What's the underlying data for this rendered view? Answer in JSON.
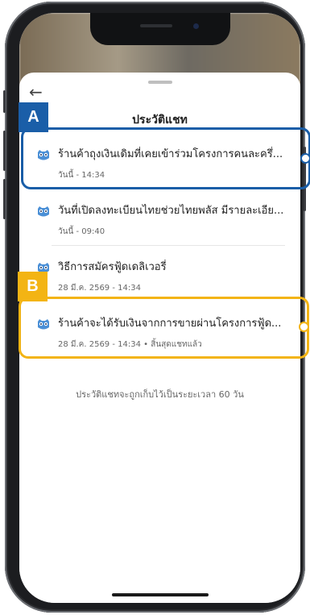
{
  "sheet": {
    "title": "ประวัติแชท",
    "footer_note": "ประวัติแชทจะถูกเก็บไว้เป็นระยะเวลา 60 วัน"
  },
  "chats": [
    {
      "title": "ร้านค้าถุงเงินเดิมที่เคยเข้าร่วมโครงการคนละครึ่...",
      "meta": "วันนี้ - 14:34"
    },
    {
      "title": "วันที่เปิดลงทะเบียนไทยช่วยไทยพลัส มีรายละเอีย...",
      "meta": "วันนี้ - 09:40"
    },
    {
      "title": "วิธีการสมัครฟู้ดเดลิเวอรี่",
      "meta": "28 มี.ค. 2569 - 14:34"
    },
    {
      "title": "ร้านค้าจะได้รับเงินจากการขายผ่านโครงการฟู้ด...",
      "meta": "28 มี.ค. 2569 - 14:34  •  สิ้นสุดแชทแล้ว"
    }
  ],
  "callouts": {
    "a": "A",
    "b": "B"
  },
  "colors": {
    "callout_a": "#1a5ea8",
    "callout_b": "#f3b414",
    "chat_icon": "#4a8fd6"
  },
  "icons": {
    "back": "arrow-left-icon",
    "chat": "owl-bot-icon"
  }
}
